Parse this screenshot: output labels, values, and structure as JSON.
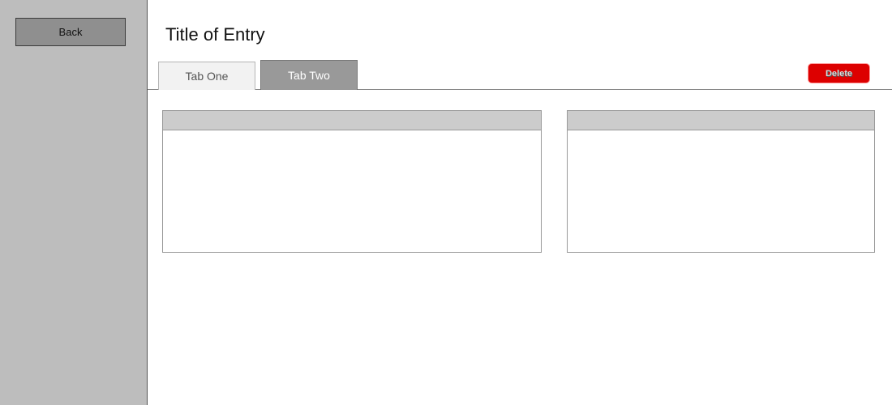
{
  "sidebar": {
    "back_label": "Back"
  },
  "main": {
    "title": "Title of Entry",
    "tabs": [
      {
        "label": "Tab One",
        "active": false
      },
      {
        "label": "Tab Two",
        "active": true
      }
    ],
    "delete_label": "Delete",
    "panels": [
      {
        "header": "",
        "body": ""
      },
      {
        "header": "",
        "body": ""
      }
    ]
  },
  "colors": {
    "sidebar_bg": "#bdbdbd",
    "delete_bg": "#dd0000",
    "active_tab_bg": "#999999",
    "inactive_tab_bg": "#f2f2f2",
    "panel_header_bg": "#cccccc"
  }
}
